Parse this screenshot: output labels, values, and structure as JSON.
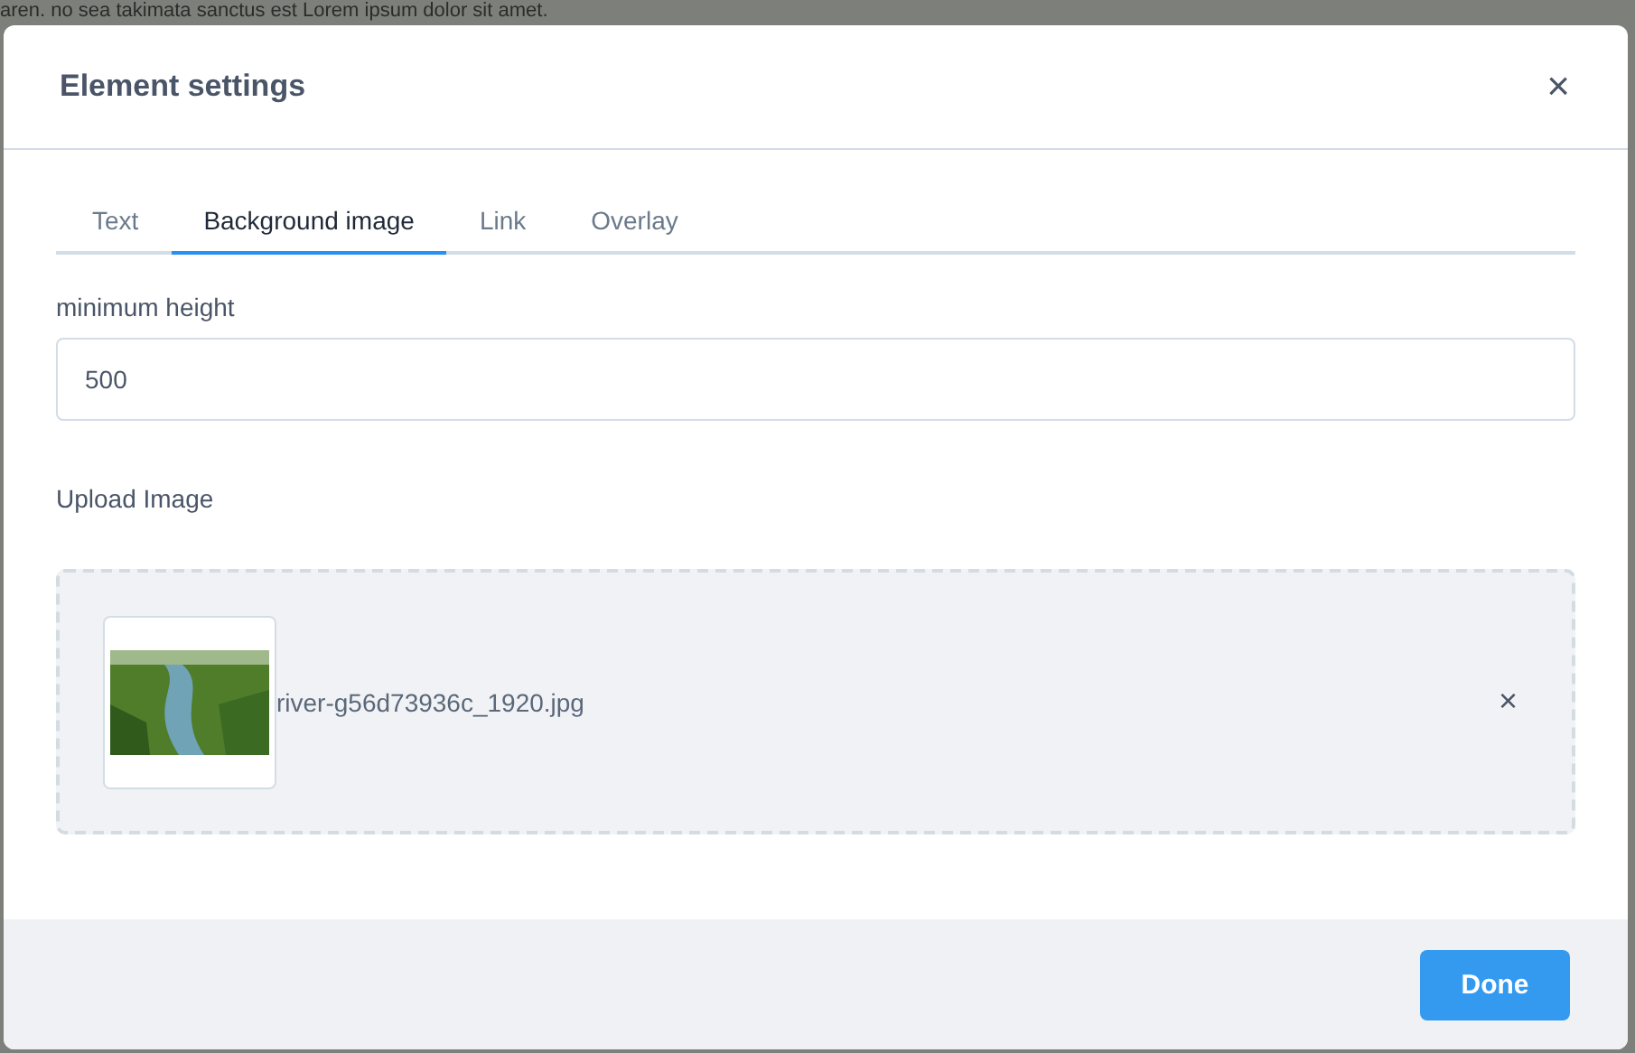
{
  "background_text": "aren. no sea takimata sanctus est Lorem ipsum dolor sit amet.",
  "dialog": {
    "title": "Element settings",
    "close": "×"
  },
  "tabs": [
    {
      "label": "Text",
      "selected": false
    },
    {
      "label": "Background image",
      "selected": true
    },
    {
      "label": "Link",
      "selected": false
    },
    {
      "label": "Overlay",
      "selected": false
    }
  ],
  "min_height": {
    "label": "minimum height",
    "value": "500"
  },
  "upload": {
    "label": "Upload Image",
    "file_name": "river-g56d73936c_1920.jpg",
    "remove": "×"
  },
  "buttons": [
    "Done"
  ]
}
